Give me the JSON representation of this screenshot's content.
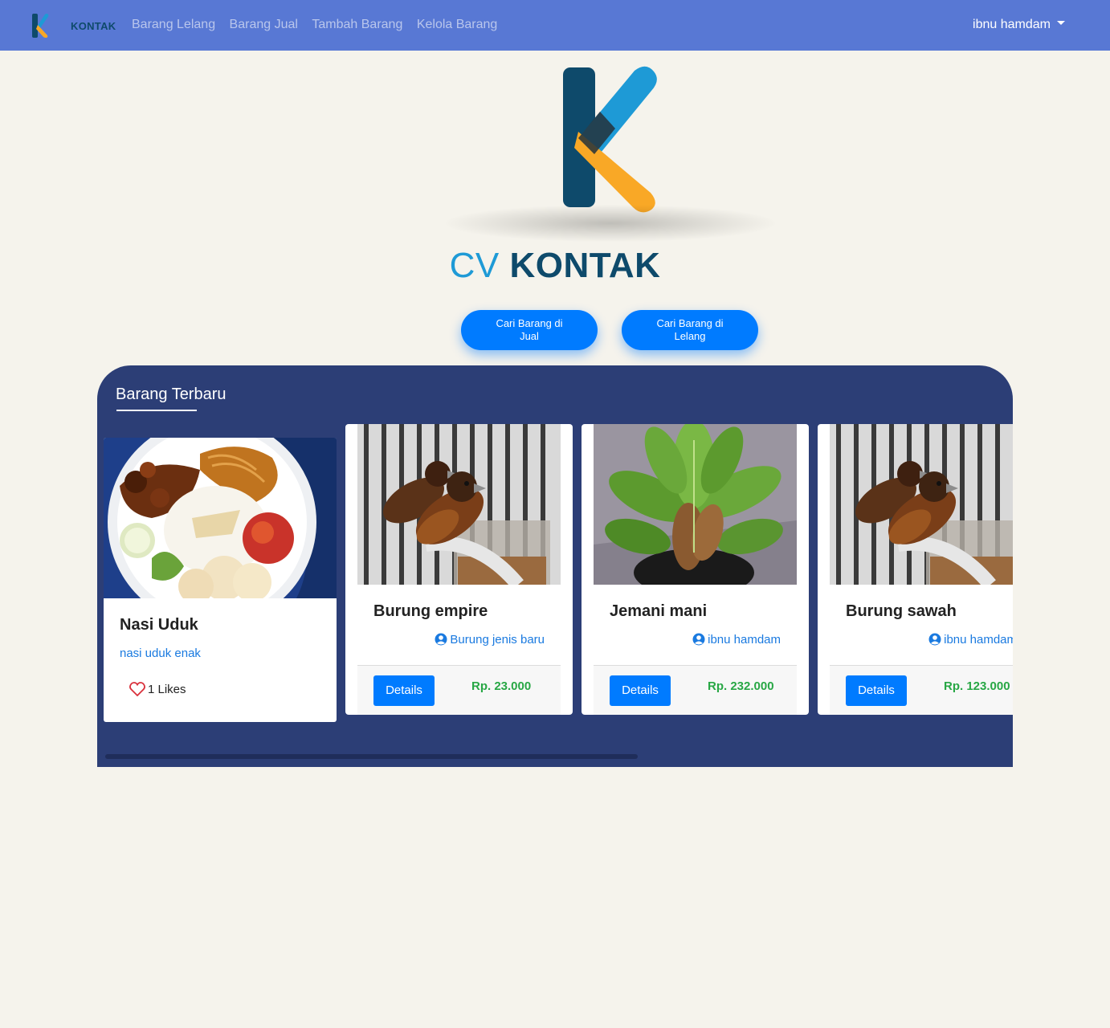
{
  "navbar": {
    "brand_text": "KONTAK",
    "links": [
      "Barang Lelang",
      "Barang Jual",
      "Tambah Barang",
      "Kelola Barang"
    ],
    "user": "ibnu hamdam"
  },
  "hero": {
    "title_cv": "CV",
    "title_kontak": "KONTAK",
    "button_jual": "Cari Barang di Jual",
    "button_lelang": "Cari Barang di Lelang"
  },
  "colors": {
    "navbar": "#5878d4",
    "background": "#f5f3ec",
    "section": "#2c3e76",
    "primary": "#007bff",
    "price": "#28a745",
    "logo_dark": "#0e4a6b",
    "logo_blue": "#1e9ad6",
    "logo_orange": "#f9a826"
  },
  "section": {
    "title": "Barang Terbaru"
  },
  "featured": {
    "name": "Nasi Uduk",
    "description": "nasi uduk enak",
    "likes": "1 Likes",
    "icon": "heart-icon"
  },
  "products": [
    {
      "name": "Burung empire",
      "seller": "Burung jenis baru",
      "details_label": "Details",
      "price": "Rp. 23.000"
    },
    {
      "name": "Jemani mani",
      "seller": "ibnu hamdam",
      "details_label": "Details",
      "price": "Rp. 232.000"
    },
    {
      "name": "Burung sawah",
      "seller": "ibnu hamdam",
      "details_label": "Details",
      "price": "Rp. 123.000"
    }
  ]
}
